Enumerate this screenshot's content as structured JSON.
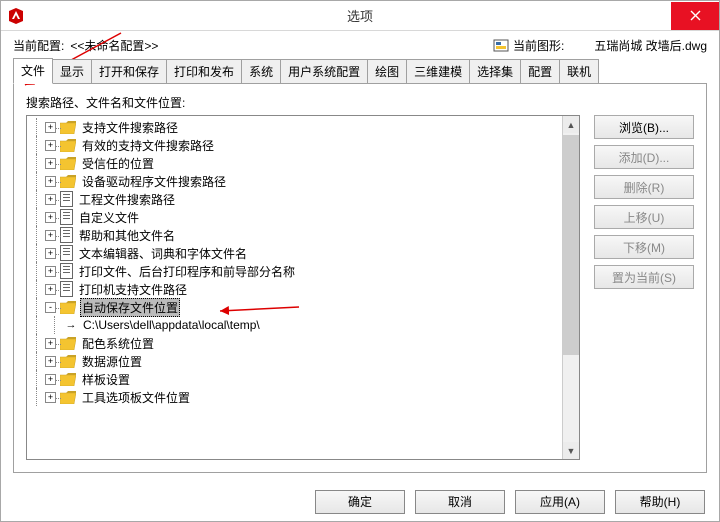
{
  "window": {
    "title": "选项"
  },
  "info": {
    "profile_label": "当前配置:",
    "profile_value": "<<未命名配置>>",
    "drawing_label": "当前图形:",
    "drawing_value": "五瑞尚城 改墙后.dwg"
  },
  "tabs": [
    "文件",
    "显示",
    "打开和保存",
    "打印和发布",
    "系统",
    "用户系统配置",
    "绘图",
    "三维建模",
    "选择集",
    "配置",
    "联机"
  ],
  "active_tab": 0,
  "panel_label": "搜索路径、文件名和文件位置:",
  "tree": [
    {
      "exp": "+",
      "icon": "folder",
      "label": "支持文件搜索路径"
    },
    {
      "exp": "+",
      "icon": "folder",
      "label": "有效的支持文件搜索路径"
    },
    {
      "exp": "+",
      "icon": "folder",
      "label": "受信任的位置"
    },
    {
      "exp": "+",
      "icon": "folder",
      "label": "设备驱动程序文件搜索路径"
    },
    {
      "exp": "+",
      "icon": "doc",
      "label": "工程文件搜索路径"
    },
    {
      "exp": "+",
      "icon": "doc",
      "label": "自定义文件"
    },
    {
      "exp": "+",
      "icon": "doc",
      "label": "帮助和其他文件名"
    },
    {
      "exp": "+",
      "icon": "doc",
      "label": "文本编辑器、词典和字体文件名"
    },
    {
      "exp": "+",
      "icon": "doc",
      "label": "打印文件、后台打印程序和前导部分名称"
    },
    {
      "exp": "+",
      "icon": "doc",
      "label": "打印机支持文件路径"
    },
    {
      "exp": "-",
      "icon": "folder",
      "label": "自动保存文件位置",
      "selected": true
    },
    {
      "child": true,
      "label": "C:\\Users\\dell\\appdata\\local\\temp\\"
    },
    {
      "exp": "+",
      "icon": "folder",
      "label": "配色系统位置"
    },
    {
      "exp": "+",
      "icon": "folder",
      "label": "数据源位置"
    },
    {
      "exp": "+",
      "icon": "folder",
      "label": "样板设置"
    },
    {
      "exp": "+",
      "icon": "folder",
      "label": "工具选项板文件位置"
    }
  ],
  "side_buttons": [
    {
      "label": "浏览(B)...",
      "enabled": true
    },
    {
      "label": "添加(D)...",
      "enabled": false
    },
    {
      "label": "删除(R)",
      "enabled": false
    },
    {
      "label": "上移(U)",
      "enabled": false
    },
    {
      "label": "下移(M)",
      "enabled": false
    },
    {
      "label": "置为当前(S)",
      "enabled": false
    }
  ],
  "bottom_buttons": [
    "确定",
    "取消",
    "应用(A)",
    "帮助(H)"
  ]
}
